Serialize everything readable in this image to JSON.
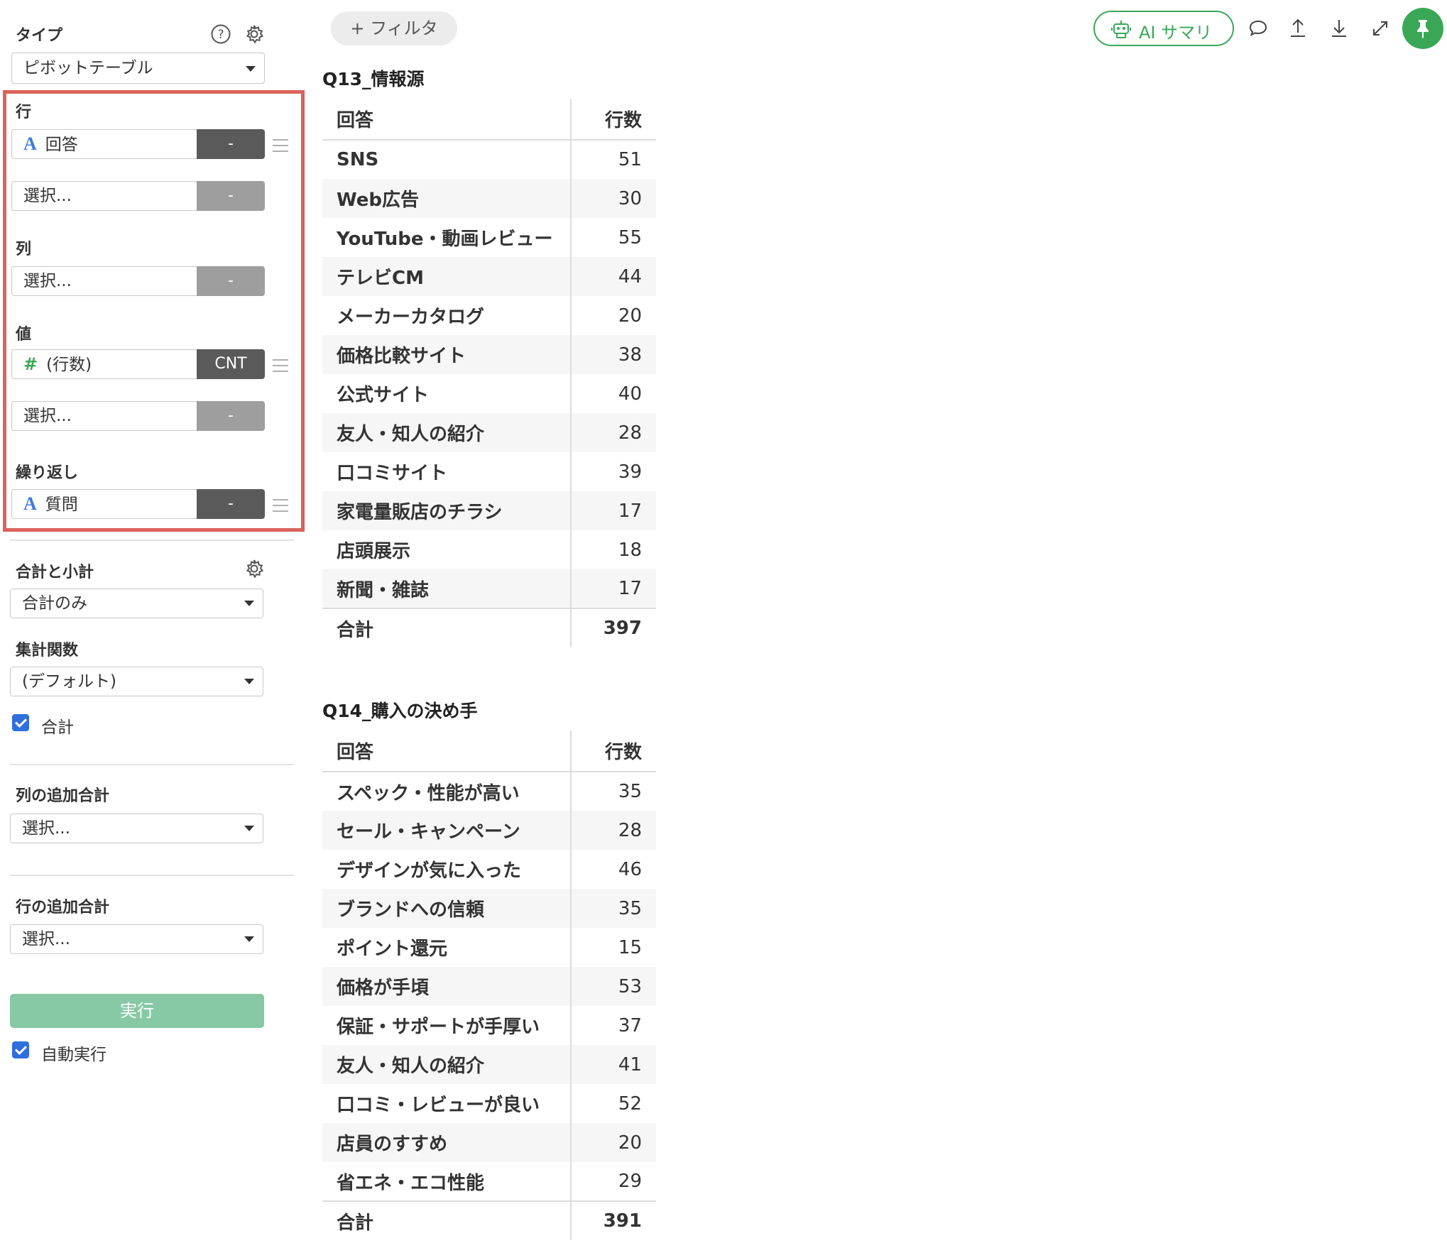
{
  "sidebar": {
    "type_label": "タイプ",
    "type_value": "ピボットテーブル",
    "rows_label": "行",
    "rows_field": "回答",
    "rows_field_agg": "-",
    "rows_select": "選択...",
    "rows_select_agg": "-",
    "cols_label": "列",
    "cols_select": "選択...",
    "cols_select_agg": "-",
    "values_label": "値",
    "values_field": "(行数)",
    "values_field_agg": "CNT",
    "values_select": "選択...",
    "values_select_agg": "-",
    "repeat_label": "繰り返し",
    "repeat_field": "質問",
    "repeat_field_agg": "-",
    "totals_label": "合計と小計",
    "totals_value": "合計のみ",
    "aggfunc_label": "集計関数",
    "aggfunc_value": "(デフォルト)",
    "total_checkbox_label": "合計",
    "col_extra_label": "列の追加合計",
    "col_extra_value": "選択...",
    "row_extra_label": "行の追加合計",
    "row_extra_value": "選択...",
    "run_button": "実行",
    "auto_run_label": "自動実行"
  },
  "toolbar": {
    "filter_button": "+ フィルタ",
    "ai_summary_button": "AI サマリ"
  },
  "table1": {
    "title": "Q13_情報源",
    "headers": [
      "回答",
      "行数"
    ],
    "rows": [
      [
        "SNS",
        "51"
      ],
      [
        "Web広告",
        "30"
      ],
      [
        "YouTube・動画レビュー",
        "55"
      ],
      [
        "テレビCM",
        "44"
      ],
      [
        "メーカーカタログ",
        "20"
      ],
      [
        "価格比較サイト",
        "38"
      ],
      [
        "公式サイト",
        "40"
      ],
      [
        "友人・知人の紹介",
        "28"
      ],
      [
        "口コミサイト",
        "39"
      ],
      [
        "家電量販店のチラシ",
        "17"
      ],
      [
        "店頭展示",
        "18"
      ],
      [
        "新聞・雑誌",
        "17"
      ]
    ],
    "total_label": "合計",
    "total_value": "397"
  },
  "table2": {
    "title": "Q14_購入の決め手",
    "headers": [
      "回答",
      "行数"
    ],
    "rows": [
      [
        "スペック・性能が高い",
        "35"
      ],
      [
        "セール・キャンペーン",
        "28"
      ],
      [
        "デザインが気に入った",
        "46"
      ],
      [
        "ブランドへの信頼",
        "35"
      ],
      [
        "ポイント還元",
        "15"
      ],
      [
        "価格が手頃",
        "53"
      ],
      [
        "保証・サポートが手厚い",
        "37"
      ],
      [
        "友人・知人の紹介",
        "41"
      ],
      [
        "口コミ・レビューが良い",
        "52"
      ],
      [
        "店員のすすめ",
        "20"
      ],
      [
        "省エネ・エコ性能",
        "29"
      ]
    ],
    "total_label": "合計",
    "total_value": "391"
  },
  "colors": {
    "highlight_border": "#d9625a",
    "run_button": "#86c9a4",
    "ai_summary": "#3aa757",
    "pin_button": "#3aa757",
    "checkbox": "#2f6fde"
  },
  "icons": [
    "help-icon",
    "gear-icon",
    "drag-handle-icon",
    "comment-icon",
    "upload-icon",
    "download-icon",
    "expand-icon",
    "pin-icon",
    "robot-icon"
  ]
}
